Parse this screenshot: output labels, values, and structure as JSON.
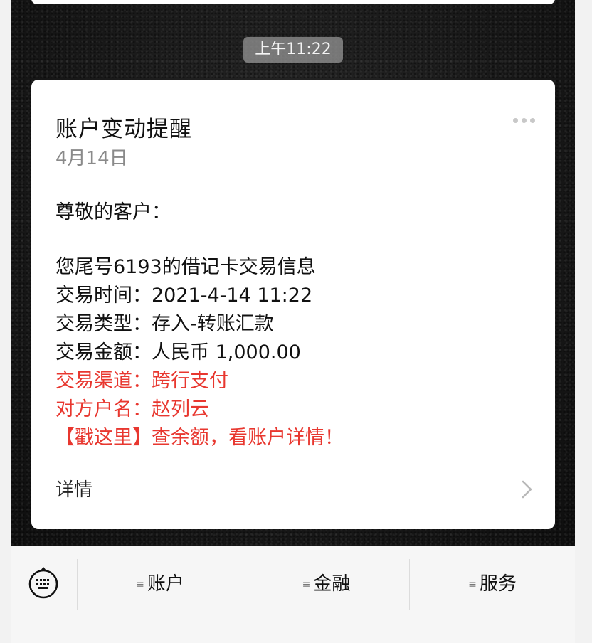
{
  "chat": {
    "timestamp": "上午11:22"
  },
  "card": {
    "title": "账户变动提醒",
    "date": "4月14日",
    "greeting": "尊敬的客户：",
    "lines": [
      "您尾号6193的借记卡交易信息",
      "交易时间：2021-4-14 11:22",
      "交易类型：存入-转账汇款",
      "交易金额：人民币 1,000.00"
    ],
    "red_lines": [
      "交易渠道：跨行支付",
      "对方户名：赵列云",
      "【戳这里】查余额，看账户详情！"
    ],
    "detail_label": "详情",
    "more_icon": "more-dots-icon",
    "detail_icon": "chevron-right-icon"
  },
  "menu": {
    "keyboard_icon": "keyboard-icon",
    "menu_icon": "menu-lines-icon",
    "items": [
      "账户",
      "金融",
      "服务"
    ]
  },
  "colors": {
    "alert_red": "#e8372f",
    "card_bg": "#ffffff",
    "time_pill_bg": "#969696",
    "muted_text": "#8a8a8a"
  }
}
